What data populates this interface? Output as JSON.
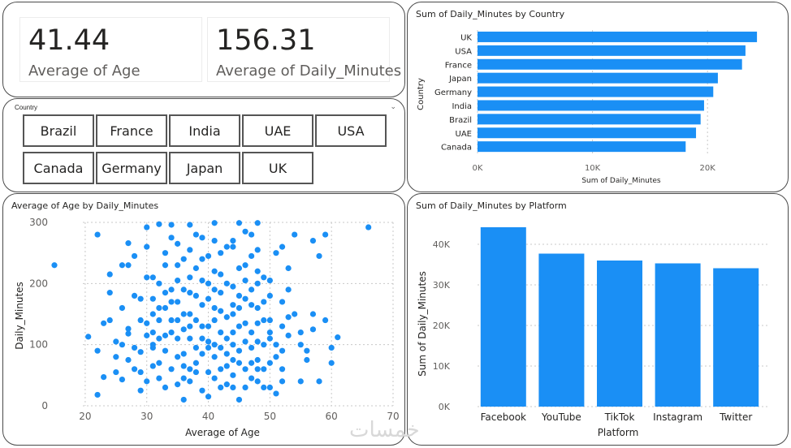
{
  "cards": [
    {
      "value": "41.44",
      "label": "Average of Age"
    },
    {
      "value": "156.31",
      "label": "Average of Daily_Minutes"
    }
  ],
  "slicer": {
    "title": "Country",
    "items": [
      "Brazil",
      "France",
      "India",
      "UAE",
      "USA",
      "Canada",
      "Germany",
      "Japan",
      "UK"
    ]
  },
  "watermark": "خمسات",
  "colors": {
    "bar": "#1a8ff5",
    "grid": "#c8c8c8"
  },
  "chart_data": [
    {
      "type": "bar",
      "orientation": "horizontal",
      "title": "Sum of Daily_Minutes by Country",
      "ylabel": "Country",
      "xlabel": "Sum of Daily_Minutes",
      "categories": [
        "UK",
        "USA",
        "France",
        "Japan",
        "Germany",
        "India",
        "Brazil",
        "UAE",
        "Canada"
      ],
      "values": [
        24300,
        23300,
        23000,
        20900,
        20500,
        19700,
        19400,
        19000,
        18100
      ],
      "xticks": [
        "0K",
        "10K",
        "20K"
      ],
      "xlim": [
        0,
        25000
      ]
    },
    {
      "type": "scatter",
      "title": "Average of Age by Daily_Minutes",
      "xlabel": "Average of Age",
      "ylabel": "Daily_Minutes",
      "xlim": [
        15,
        70
      ],
      "ylim": [
        0,
        300
      ],
      "xticks": [
        "20",
        "30",
        "40",
        "50",
        "60",
        "70"
      ],
      "yticks": [
        "0",
        "100",
        "200",
        "300"
      ],
      "points": [
        [
          15,
          230
        ],
        [
          66,
          292
        ],
        [
          20.5,
          113
        ],
        [
          22,
          18
        ],
        [
          22,
          280
        ],
        [
          23,
          47
        ],
        [
          24,
          215
        ],
        [
          24,
          140
        ],
        [
          25,
          105
        ],
        [
          26,
          43
        ],
        [
          26,
          230
        ],
        [
          27,
          266
        ],
        [
          27,
          126
        ],
        [
          30,
          292
        ],
        [
          32,
          297
        ],
        [
          34,
          296
        ],
        [
          37,
          296
        ],
        [
          41,
          299
        ],
        [
          45,
          299
        ],
        [
          48,
          299
        ],
        [
          22,
          90
        ],
        [
          23,
          135
        ],
        [
          24,
          185
        ],
        [
          25,
          55
        ],
        [
          26,
          160
        ],
        [
          27,
          118
        ],
        [
          28,
          60
        ],
        [
          28,
          245
        ],
        [
          29,
          175
        ],
        [
          29,
          88
        ],
        [
          30,
          135
        ],
        [
          30,
          40
        ],
        [
          31,
          210
        ],
        [
          31,
          100
        ],
        [
          32,
          70
        ],
        [
          32,
          160
        ],
        [
          33,
          250
        ],
        [
          33,
          30
        ],
        [
          34,
          120
        ],
        [
          34,
          190
        ],
        [
          35,
          80
        ],
        [
          35,
          265
        ],
        [
          36,
          150
        ],
        [
          36,
          45
        ],
        [
          37,
          210
        ],
        [
          37,
          110
        ],
        [
          38,
          70
        ],
        [
          38,
          180
        ],
        [
          39,
          240
        ],
        [
          39,
          130
        ],
        [
          40,
          95
        ],
        [
          40,
          15
        ],
        [
          41,
          160
        ],
        [
          41,
          220
        ],
        [
          42,
          60
        ],
        [
          42,
          120
        ],
        [
          43,
          200
        ],
        [
          43,
          35
        ],
        [
          44,
          150
        ],
        [
          44,
          260
        ],
        [
          45,
          90
        ],
        [
          45,
          180
        ],
        [
          46,
          230
        ],
        [
          46,
          60
        ],
        [
          47,
          120
        ],
        [
          47,
          280
        ],
        [
          48,
          160
        ],
        [
          48,
          40
        ],
        [
          49,
          210
        ],
        [
          49,
          100
        ],
        [
          50,
          70
        ],
        [
          50,
          140
        ],
        [
          51,
          250
        ],
        [
          51,
          20
        ],
        [
          52,
          130
        ],
        [
          52,
          60
        ],
        [
          53,
          190
        ],
        [
          54,
          150
        ],
        [
          55,
          100
        ],
        [
          56,
          75
        ],
        [
          57,
          270
        ],
        [
          58,
          40
        ],
        [
          59,
          140
        ],
        [
          60,
          70
        ],
        [
          58,
          245
        ],
        [
          59,
          280
        ],
        [
          60,
          95
        ],
        [
          61,
          112
        ],
        [
          55,
          120
        ],
        [
          53,
          225
        ],
        [
          54,
          280
        ],
        [
          56,
          90
        ],
        [
          57,
          150
        ],
        [
          52,
          170
        ],
        [
          33,
          115
        ],
        [
          36,
          85
        ],
        [
          38,
          55
        ],
        [
          40,
          175
        ],
        [
          42,
          185
        ],
        [
          44,
          75
        ],
        [
          46,
          105
        ],
        [
          31,
          175
        ],
        [
          35,
          230
        ],
        [
          39,
          205
        ],
        [
          43,
          85
        ],
        [
          47,
          165
        ],
        [
          49,
          140
        ],
        [
          34,
          60
        ],
        [
          37,
          150
        ],
        [
          41,
          45
        ],
        [
          45,
          130
        ],
        [
          48,
          200
        ],
        [
          50,
          120
        ],
        [
          30,
          115
        ],
        [
          32,
          200
        ],
        [
          36,
          125
        ],
        [
          38,
          280
        ],
        [
          42,
          250
        ],
        [
          44,
          50
        ],
        [
          46,
          175
        ],
        [
          49,
          60
        ],
        [
          51,
          100
        ],
        [
          29,
          140
        ],
        [
          33,
          160
        ],
        [
          37,
          40
        ],
        [
          40,
          130
        ],
        [
          43,
          260
        ],
        [
          45,
          10
        ],
        [
          47,
          70
        ],
        [
          50,
          110
        ],
        [
          52,
          260
        ],
        [
          28,
          95
        ],
        [
          31,
          65
        ],
        [
          35,
          170
        ],
        [
          39,
          110
        ],
        [
          41,
          80
        ],
        [
          44,
          195
        ],
        [
          48,
          105
        ],
        [
          34,
          275
        ],
        [
          38,
          225
        ],
        [
          42,
          30
        ],
        [
          46,
          285
        ],
        [
          30,
          210
        ],
        [
          36,
          190
        ],
        [
          40,
          55
        ],
        [
          44,
          120
        ],
        [
          48,
          75
        ],
        [
          35,
          110
        ],
        [
          39,
          25
        ],
        [
          43,
          145
        ],
        [
          47,
          95
        ],
        [
          33,
          90
        ],
        [
          37,
          255
        ],
        [
          41,
          140
        ],
        [
          45,
          225
        ],
        [
          49,
          170
        ],
        [
          32,
          45
        ],
        [
          36,
          10
        ],
        [
          40,
          245
        ],
        [
          44,
          100
        ],
        [
          48,
          135
        ],
        [
          31,
          150
        ],
        [
          35,
          205
        ],
        [
          39,
          165
        ],
        [
          43,
          110
        ],
        [
          47,
          45
        ],
        [
          51,
          80
        ],
        [
          29,
          25
        ],
        [
          33,
          230
        ],
        [
          37,
          185
        ],
        [
          41,
          100
        ],
        [
          45,
          160
        ],
        [
          49,
          30
        ],
        [
          27,
          230
        ],
        [
          30,
          260
        ],
        [
          34,
          140
        ],
        [
          38,
          95
        ],
        [
          42,
          155
        ],
        [
          46,
          30
        ],
        [
          50,
          180
        ],
        [
          26,
          100
        ],
        [
          28,
          180
        ],
        [
          32,
          110
        ],
        [
          36,
          240
        ],
        [
          40,
          200
        ],
        [
          44,
          30
        ],
        [
          48,
          255
        ],
        [
          52,
          90
        ],
        [
          25,
          80
        ],
        [
          29,
          55
        ],
        [
          33,
          185
        ],
        [
          37,
          130
        ],
        [
          41,
          270
        ],
        [
          45,
          70
        ],
        [
          47,
          245
        ],
        [
          53,
          145
        ],
        [
          55,
          40
        ],
        [
          57,
          125
        ],
        [
          42,
          215
        ],
        [
          39,
          85
        ],
        [
          35,
          35
        ],
        [
          31,
          120
        ],
        [
          27,
          75
        ],
        [
          46,
          205
        ],
        [
          50,
          30
        ],
        [
          53,
          115
        ],
        [
          41,
          190
        ],
        [
          37,
          60
        ],
        [
          44,
          270
        ],
        [
          48,
          220
        ],
        [
          34,
          170
        ],
        [
          38,
          140
        ],
        [
          42,
          95
        ],
        [
          46,
          135
        ],
        [
          50,
          205
        ],
        [
          43,
          65
        ],
        [
          39,
          275
        ],
        [
          35,
          140
        ],
        [
          31,
          95
        ],
        [
          47,
          190
        ],
        [
          32,
          140
        ],
        [
          36,
          65
        ],
        [
          40,
          105
        ],
        [
          44,
          165
        ],
        [
          48,
          60
        ],
        [
          52,
          40
        ]
      ]
    },
    {
      "type": "bar",
      "orientation": "vertical",
      "title": "Sum of Daily_Minutes by Platform",
      "xlabel": "Platform",
      "ylabel": "Sum of Daily_Minutes",
      "categories": [
        "Facebook",
        "YouTube",
        "TikTok",
        "Instagram",
        "Twitter"
      ],
      "values": [
        44200,
        37700,
        36000,
        35300,
        34100
      ],
      "yticks": [
        "0K",
        "10K",
        "20K",
        "30K",
        "40K"
      ],
      "ylim": [
        0,
        46000
      ]
    }
  ]
}
